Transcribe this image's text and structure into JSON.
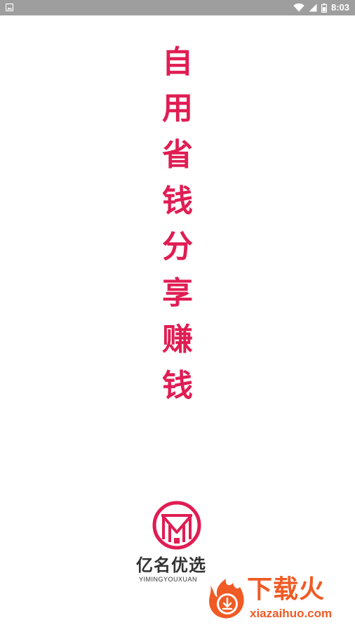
{
  "status_bar": {
    "time": "8:03",
    "icons": [
      "image-icon",
      "wifi-icon",
      "signal-icon",
      "battery-icon"
    ]
  },
  "slogan_1": {
    "chars": [
      "自",
      "用",
      "省",
      "钱"
    ]
  },
  "slogan_2": {
    "chars": [
      "分",
      "享",
      "赚",
      "钱"
    ]
  },
  "logo": {
    "name": "亿名优选",
    "pinyin": "YIMINGYOUXUAN"
  },
  "watermark": {
    "title": "下载火",
    "url": "xiazaihuo.com"
  },
  "colors": {
    "accent": "#e01d53",
    "status_bar": "#9e9e9e",
    "watermark": "#f05a24",
    "text_dark": "#333333"
  }
}
